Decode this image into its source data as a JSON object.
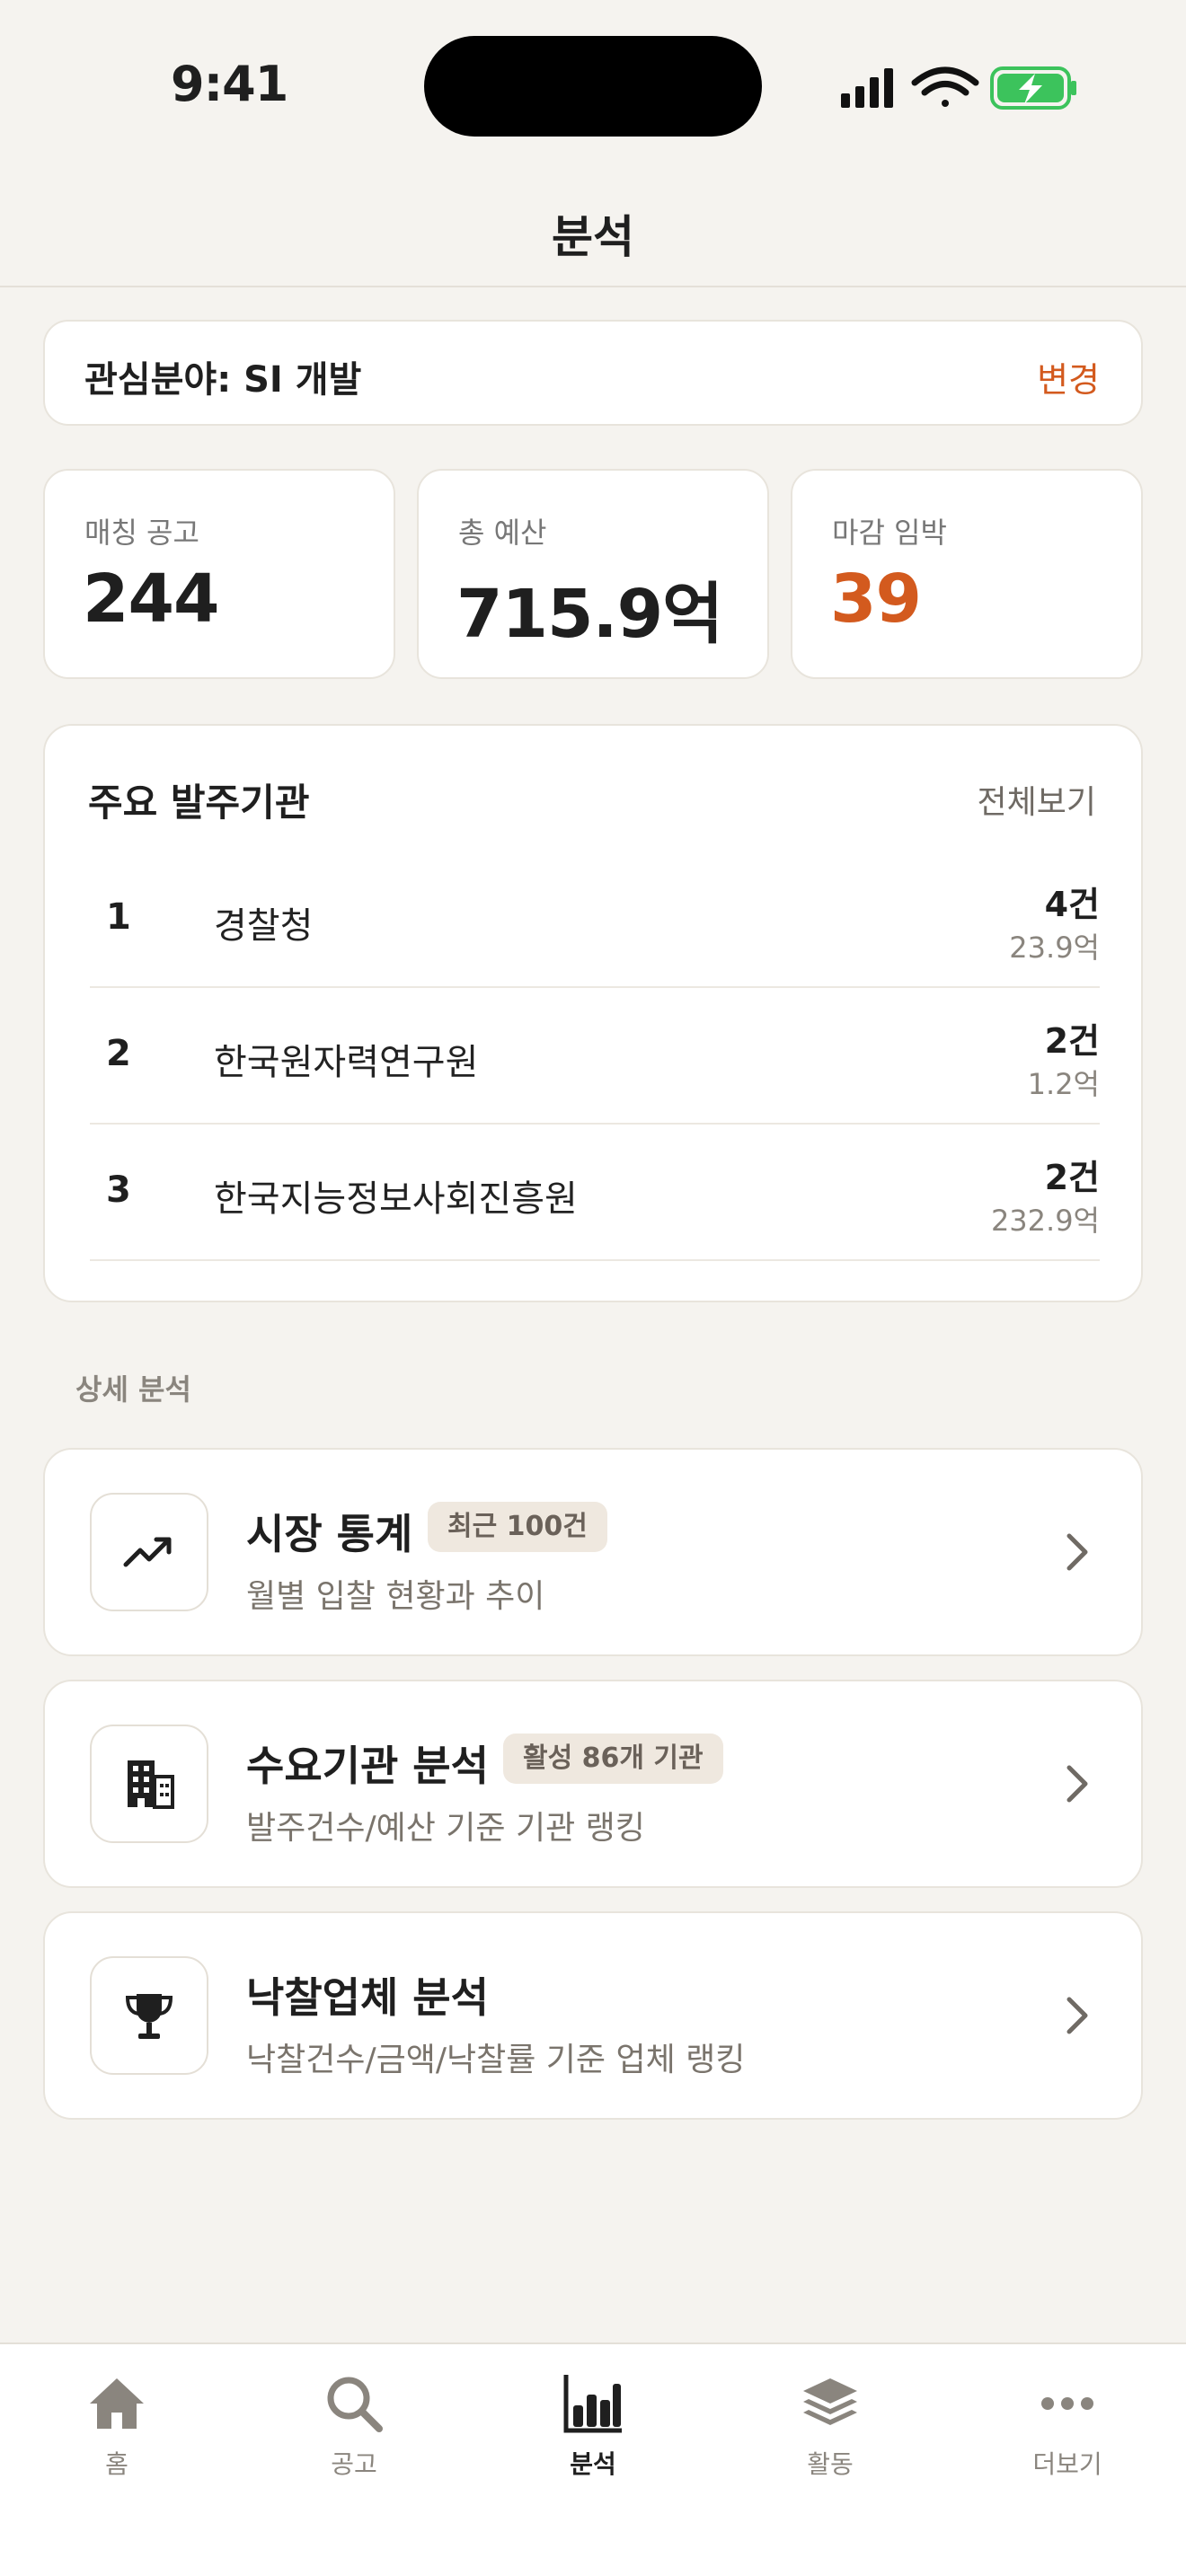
{
  "status_bar": {
    "time": "9:41"
  },
  "header": {
    "title": "분석"
  },
  "interest": {
    "label": "관심분야: SI 개발",
    "change": "변경"
  },
  "stats": [
    {
      "label": "매칭 공고",
      "value": "244"
    },
    {
      "label": "총 예산",
      "value": "715.9억"
    },
    {
      "label": "마감 임박",
      "value": "39"
    }
  ],
  "agencies": {
    "title": "주요 발주기관",
    "view_all": "전체보기",
    "items": [
      {
        "rank": "1",
        "name": "경찰청",
        "count": "4건",
        "amount": "23.9억"
      },
      {
        "rank": "2",
        "name": "한국원자력연구원",
        "count": "2건",
        "amount": "1.2억"
      },
      {
        "rank": "3",
        "name": "한국지능정보사회진흥원",
        "count": "2건",
        "amount": "232.9억"
      }
    ]
  },
  "details": {
    "section_label": "상세 분석",
    "items": [
      {
        "title": "시장 통계",
        "badge": "최근 100건",
        "subtitle": "월별 입찰 현황과 추이",
        "icon": "trending-up-icon"
      },
      {
        "title": "수요기관 분석",
        "badge": "활성 86개 기관",
        "subtitle": "발주건수/예산 기준 기관 랭킹",
        "icon": "building-icon"
      },
      {
        "title": "낙찰업체 분석",
        "badge": "",
        "subtitle": "낙찰건수/금액/낙찰률 기준 업체 랭킹",
        "icon": "trophy-icon"
      }
    ]
  },
  "tabs": [
    {
      "label": "홈",
      "icon": "home-icon"
    },
    {
      "label": "공고",
      "icon": "search-icon"
    },
    {
      "label": "분석",
      "icon": "bar-chart-icon",
      "active": true
    },
    {
      "label": "활동",
      "icon": "layers-icon"
    },
    {
      "label": "더보기",
      "icon": "more-icon"
    }
  ],
  "colors": {
    "accent": "#d35a1e",
    "background": "#f5f3ef",
    "battery": "#3cc35c"
  }
}
